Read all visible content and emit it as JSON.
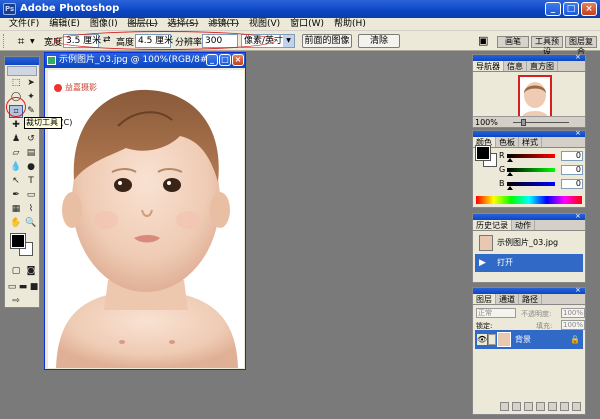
{
  "app": {
    "title": "Adobe Photoshop"
  },
  "menu": [
    "文件(F)",
    "编辑(E)",
    "图像(I)",
    "图层(L)",
    "选择(S)",
    "滤镜(T)",
    "视图(V)",
    "窗口(W)",
    "帮助(H)"
  ],
  "options": {
    "width_label": "宽度:",
    "width_value": "3.5 厘米",
    "height_label": "高度:",
    "height_value": "4.5 厘米",
    "resolution_label": "分辨率:",
    "resolution_value": "300",
    "unit_value": "像素/英寸",
    "front_image_button": "前面的图像",
    "clear_button": "清除"
  },
  "well": {
    "brushes_tab": "画笔",
    "tool_presets_tab": "工具预设",
    "layer_comps_tab": "图层复合"
  },
  "tooltip": "裁切工具 (C)",
  "document": {
    "title": "示例图片_03.jpg @ 100%(RGB/8#)",
    "watermark": "益嘉摄影"
  },
  "navigator": {
    "tabs": [
      "导航器",
      "信息",
      "直方图"
    ],
    "zoom": "100%"
  },
  "color_panel": {
    "tabs": [
      "颜色",
      "色板",
      "样式"
    ],
    "channels": [
      {
        "label": "R",
        "value": "0",
        "color": "#c00000"
      },
      {
        "label": "G",
        "value": "0",
        "color": "#00a000"
      },
      {
        "label": "B",
        "value": "0",
        "color": "#0000c0"
      }
    ]
  },
  "history": {
    "tabs": [
      "历史记录",
      "动作"
    ],
    "items": [
      "示例图片_03.jpg",
      "打开"
    ]
  },
  "layers": {
    "tabs": [
      "图层",
      "通道",
      "路径"
    ],
    "blend_mode": "正常",
    "opacity_label": "不透明度:",
    "opacity_value": "100%",
    "lock_label": "锁定:",
    "fill_label": "填充:",
    "fill_value": "100%",
    "layer_name": "背景"
  },
  "colors": {
    "title_blue": "#0b46c4",
    "highlight": "#3169c6",
    "annotation_red": "#d62020"
  }
}
